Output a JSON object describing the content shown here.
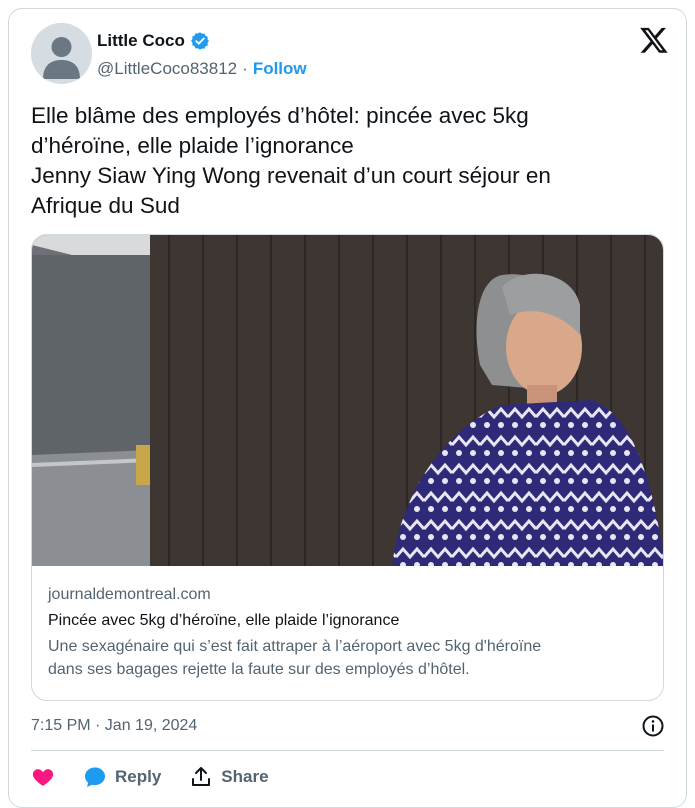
{
  "author": {
    "display_name": "Little Coco",
    "handle": "@LittleCoco83812",
    "separator": "·",
    "follow_label": "Follow",
    "verified_icon": "verified-badge-icon"
  },
  "tweet": {
    "lines": [
      "Elle blâme des employés d’hôtel: pincée avec 5kg",
      "d’héroïne, elle plaide l’ignorance",
      "Jenny Siaw Ying Wong revenait d’un court séjour en",
      "Afrique du Sud"
    ],
    "timestamp": "7:15 PM · Jan 19, 2024"
  },
  "card": {
    "domain": "journaldemontreal.com",
    "title": "Pincée avec 5kg d’héroïne, elle plaide l’ignorance",
    "description_lines": [
      "Une sexagénaire qui s’est fait attraper à l’aéroport avec 5kg d'héroïne",
      "dans ses bagages rejette la faute sur des employés d’hôtel."
    ]
  },
  "actions": {
    "like_icon": "heart-icon",
    "reply_label": "Reply",
    "share_label": "Share"
  },
  "colors": {
    "accent": "#1d9bf0",
    "text_primary": "#0f1419",
    "text_secondary": "#536471",
    "border": "#cfd9de",
    "like": "#f91880"
  }
}
